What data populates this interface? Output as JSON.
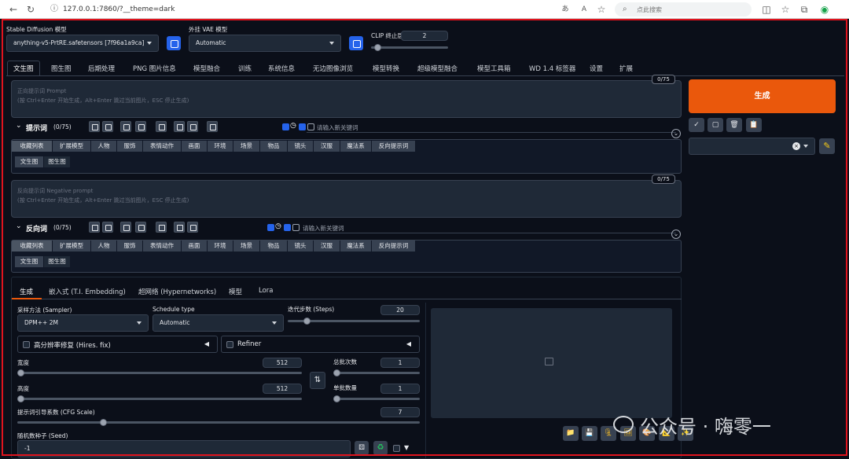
{
  "browser": {
    "url": "127.0.0.1:7860/?__theme=dark",
    "search_placeholder": "点此搜索"
  },
  "top": {
    "model_label": "Stable Diffusion 模型",
    "model_value": "anything-v5-PrtRE.safetensors [7f96a1a9ca]",
    "vae_label": "外挂 VAE 模型",
    "vae_value": "Automatic",
    "clip_label": "CLIP 终止层数",
    "clip_value": "2",
    "clip_level": 0.05
  },
  "main_tabs": [
    "文生图",
    "图生图",
    "后期处理",
    "PNG 图片信息",
    "模型融合",
    "训练",
    "系统信息",
    "无边图像浏览",
    "模型转换",
    "超级模型融合",
    "模型工具箱",
    "WD 1.4 标签器",
    "设置",
    "扩展"
  ],
  "prompt": {
    "token_count": "0/75",
    "placeholder_line1": "正向提示词 Prompt",
    "placeholder_line2": "(按 Ctrl+Enter 开始生成，Alt+Enter 跳过当前图片，ESC 停止生成)",
    "section_label": "提示词",
    "section_count": "(0/75)",
    "keyword_placeholder": "请输入新关键词"
  },
  "negative": {
    "token_count": "0/75",
    "placeholder_line1": "反向提示词 Negative prompt",
    "placeholder_line2": "(按 Ctrl+Enter 开始生成，Alt+Enter 跳过当前图片，ESC 停止生成)",
    "section_label": "反向词",
    "section_count": "(0/75)",
    "keyword_placeholder": "请输入新关键词"
  },
  "category_tabs": [
    "收藏列表",
    "扩展模型",
    "人物",
    "服饰",
    "表情动作",
    "画面",
    "环境",
    "场景",
    "物品",
    "镜头",
    "汉服",
    "魔法系",
    "反向提示词"
  ],
  "sub_tabs": [
    "文生图",
    "图生图"
  ],
  "generate": {
    "button_label": "生成"
  },
  "gen_tabs": [
    "生成",
    "嵌入式 (T.I. Embedding)",
    "超网络 (Hypernetworks)",
    "模型",
    "Lora"
  ],
  "params": {
    "sampler_label": "采样方法 (Sampler)",
    "sampler_value": "DPM++ 2M",
    "schedule_label": "Schedule type",
    "schedule_value": "Automatic",
    "steps_label": "迭代步数 (Steps)",
    "steps_value": "20",
    "hires_label": "高分辨率修复 (Hires. fix)",
    "refiner_label": "Refiner",
    "width_label": "宽度",
    "width_value": "512",
    "height_label": "高度",
    "height_value": "512",
    "batch_count_label": "总批次数",
    "batch_count_value": "1",
    "batch_size_label": "单批数量",
    "batch_size_value": "1",
    "cfg_label": "提示词引导系数 (CFG Scale)",
    "cfg_value": "7",
    "seed_label": "随机数种子 (Seed)",
    "seed_value": "-1"
  },
  "watermark": "公众号 · 嗨零一",
  "colors": {
    "accent": "#ea580c",
    "frame": "#e0141e",
    "blue": "#2563eb",
    "bg": "#0b0f19"
  }
}
